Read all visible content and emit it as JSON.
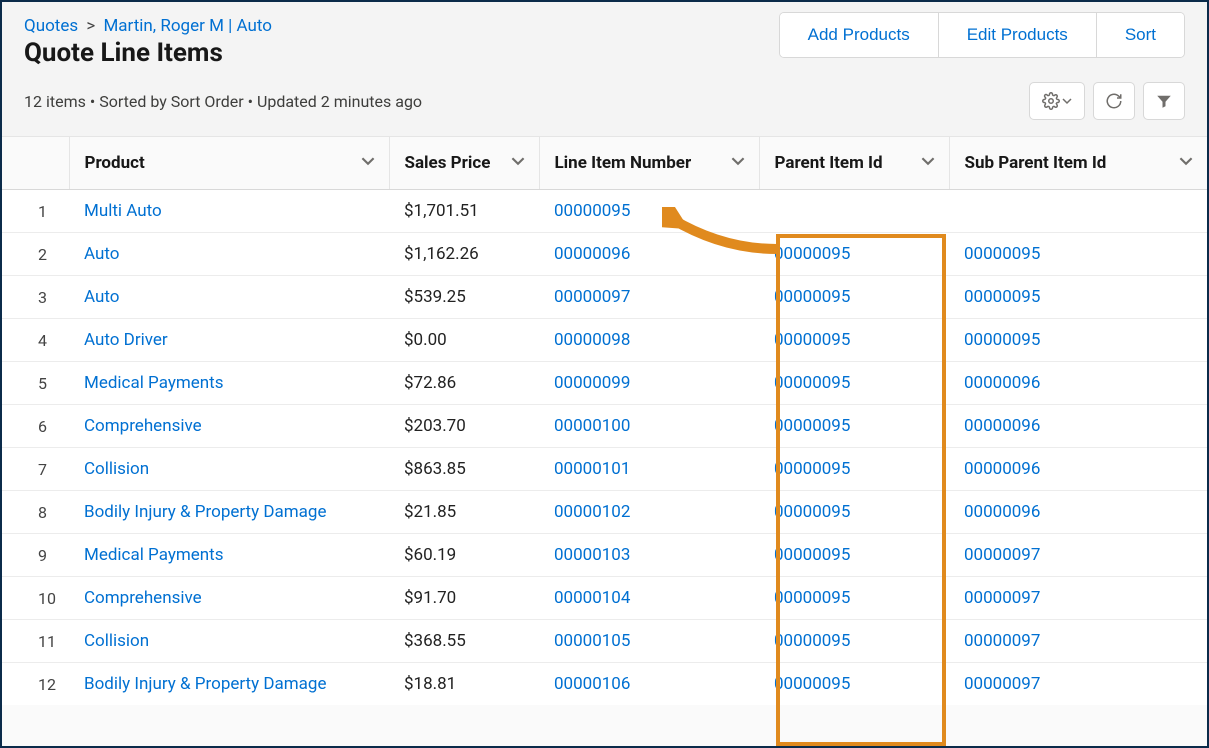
{
  "breadcrumb": {
    "root": "Quotes",
    "current": "Martin, Roger M | Auto"
  },
  "page_title": "Quote Line Items",
  "status_line": "12 items • Sorted by Sort Order • Updated 2 minutes ago",
  "header_actions": {
    "add": "Add Products",
    "edit": "Edit Products",
    "sort": "Sort"
  },
  "columns": {
    "product": "Product",
    "sales_price": "Sales Price",
    "line_item_number": "Line Item Number",
    "parent_item_id": "Parent Item Id",
    "sub_parent_item_id": "Sub Parent Item Id"
  },
  "rows": [
    {
      "n": "1",
      "product": "Multi Auto",
      "price": "$1,701.51",
      "line": "00000095",
      "parent": "",
      "sub": ""
    },
    {
      "n": "2",
      "product": "Auto",
      "price": "$1,162.26",
      "line": "00000096",
      "parent": "00000095",
      "sub": "00000095"
    },
    {
      "n": "3",
      "product": "Auto",
      "price": "$539.25",
      "line": "00000097",
      "parent": "00000095",
      "sub": "00000095"
    },
    {
      "n": "4",
      "product": "Auto Driver",
      "price": "$0.00",
      "line": "00000098",
      "parent": "00000095",
      "sub": "00000095"
    },
    {
      "n": "5",
      "product": "Medical Payments",
      "price": "$72.86",
      "line": "00000099",
      "parent": "00000095",
      "sub": "00000096"
    },
    {
      "n": "6",
      "product": "Comprehensive",
      "price": "$203.70",
      "line": "00000100",
      "parent": "00000095",
      "sub": "00000096"
    },
    {
      "n": "7",
      "product": "Collision",
      "price": "$863.85",
      "line": "00000101",
      "parent": "00000095",
      "sub": "00000096"
    },
    {
      "n": "8",
      "product": "Bodily Injury & Property Damage",
      "price": "$21.85",
      "line": "00000102",
      "parent": "00000095",
      "sub": "00000096"
    },
    {
      "n": "9",
      "product": "Medical Payments",
      "price": "$60.19",
      "line": "00000103",
      "parent": "00000095",
      "sub": "00000097"
    },
    {
      "n": "10",
      "product": "Comprehensive",
      "price": "$91.70",
      "line": "00000104",
      "parent": "00000095",
      "sub": "00000097"
    },
    {
      "n": "11",
      "product": "Collision",
      "price": "$368.55",
      "line": "00000105",
      "parent": "00000095",
      "sub": "00000097"
    },
    {
      "n": "12",
      "product": "Bodily Injury & Property Damage",
      "price": "$18.81",
      "line": "00000106",
      "parent": "00000095",
      "sub": "00000097"
    }
  ]
}
